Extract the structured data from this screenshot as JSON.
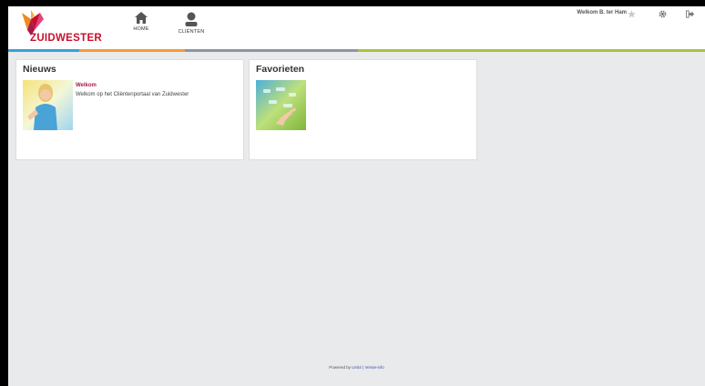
{
  "header": {
    "logo_text": "ZUIDWESTER",
    "welcome_text": "Welkom B. ter Ham",
    "nav": [
      {
        "label": "HOME",
        "icon": "home-icon"
      },
      {
        "label": "CLIËNTEN",
        "icon": "person-icon"
      }
    ],
    "top_icons": [
      "star-icon",
      "gear-icon",
      "logout-icon"
    ]
  },
  "colors": {
    "brand_red": "#c8102e",
    "brand_orange": "#f08a1c",
    "brand_pink": "#a8194a",
    "bar_blue": "#3aa0d8",
    "bar_orange": "#f59b3a",
    "bar_gray": "#8c95a6",
    "bar_green": "#a9c23f",
    "background": "#e9eaec"
  },
  "news": {
    "title": "Nieuws",
    "item_heading": "Welkom",
    "item_text": "Welkom op het Cliëntenportaal van Zuidwester"
  },
  "favorites": {
    "title": "Favorieten"
  },
  "footer": {
    "prefix": "Powered by",
    "link1": "Unit4",
    "separator": "|",
    "link2": "Versie-info"
  }
}
